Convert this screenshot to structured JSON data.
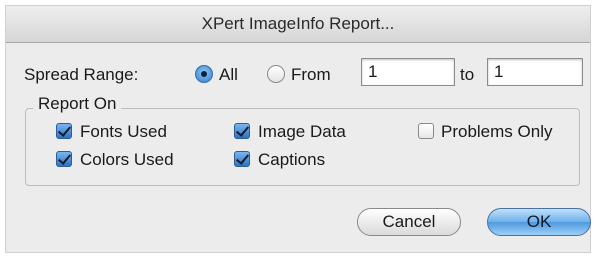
{
  "dialog": {
    "title": "XPert ImageInfo Report..."
  },
  "spread_range": {
    "label": "Spread Range:",
    "all_label": "All",
    "from_label": "From",
    "from_value": "1",
    "to_label": "to",
    "to_value": "1",
    "selected": "All"
  },
  "report_on": {
    "title": "Report On",
    "options": [
      {
        "label": "Fonts Used",
        "checked": true
      },
      {
        "label": "Image Data",
        "checked": true
      },
      {
        "label": "Problems Only",
        "checked": false
      },
      {
        "label": "Colors Used",
        "checked": true
      },
      {
        "label": "Captions",
        "checked": true
      }
    ]
  },
  "buttons": {
    "cancel_label": "Cancel",
    "ok_label": "OK"
  },
  "colors": {
    "accent": "#2f7fd0",
    "window_background": "#ececec"
  }
}
